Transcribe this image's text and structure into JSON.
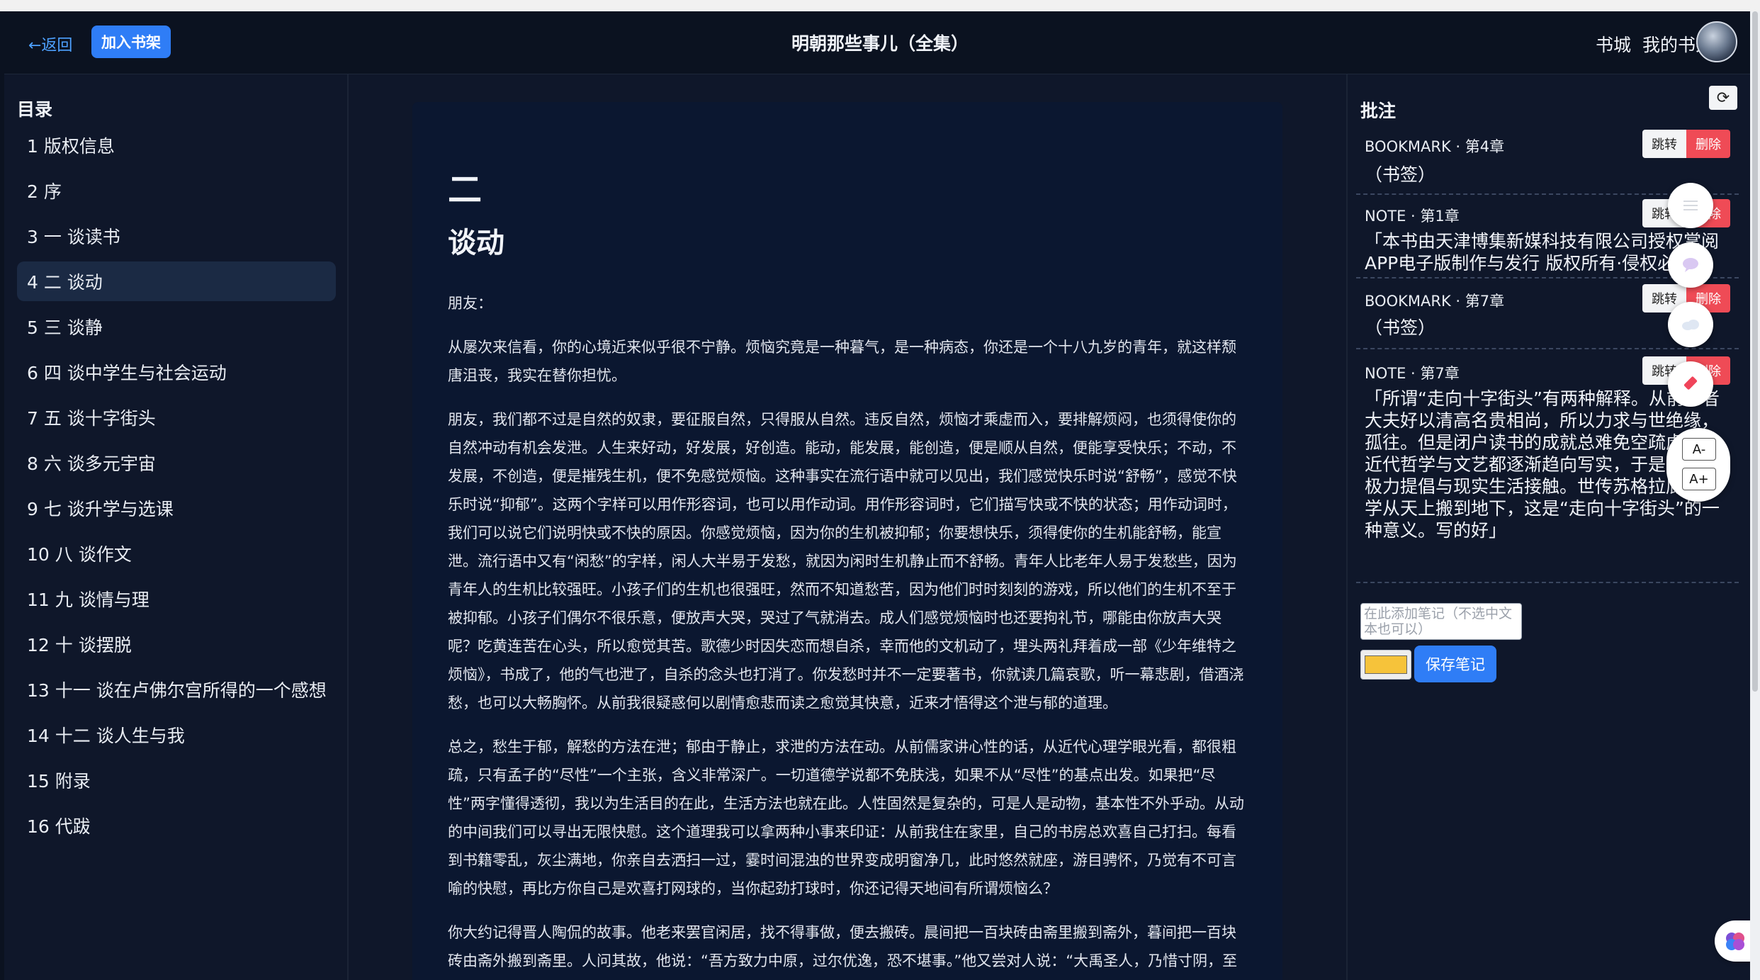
{
  "header": {
    "back_label": "←返回",
    "add_shelf_label": "加入书架",
    "title": "明朝那些事儿（全集）",
    "nav": [
      "书城",
      "我的书架"
    ]
  },
  "toc": {
    "heading": "目录",
    "items": [
      {
        "label": "1 版权信息"
      },
      {
        "label": "2 序"
      },
      {
        "label": "3 一 谈读书"
      },
      {
        "label": "4 二 谈动"
      },
      {
        "label": "5 三 谈静"
      },
      {
        "label": "6 四 谈中学生与社会运动"
      },
      {
        "label": "7 五 谈十字街头"
      },
      {
        "label": "8 六 谈多元宇宙"
      },
      {
        "label": "9 七 谈升学与选课"
      },
      {
        "label": "10 八 谈作文"
      },
      {
        "label": "11 九 谈情与理"
      },
      {
        "label": "12 十 谈摆脱"
      },
      {
        "label": "13 十一 谈在卢佛尔宫所得的一个感想"
      },
      {
        "label": "14 十二 谈人生与我"
      },
      {
        "label": "15 附录"
      },
      {
        "label": "16 代跋"
      }
    ],
    "active_index": 3
  },
  "chapter": {
    "number": "二",
    "title": "谈动",
    "paragraphs": [
      "朋友：",
      "从屡次来信看，你的心境近来似乎很不宁静。烦恼究竟是一种暮气，是一种病态，你还是一个十八九岁的青年，就这样颓唐沮丧，我实在替你担忧。",
      "朋友，我们都不过是自然的奴隶，要征服自然，只得服从自然。违反自然，烦恼才乘虚而入，要排解烦闷，也须得使你的自然冲动有机会发泄。人生来好动，好发展，好创造。能动，能发展，能创造，便是顺从自然，便能享受快乐；不动，不发展，不创造，便是摧残生机，便不免感觉烦恼。这种事实在流行语中就可以见出，我们感觉快乐时说“舒畅”，感觉不快乐时说“抑郁”。这两个字样可以用作形容词，也可以用作动词。用作形容词时，它们描写快或不快的状态；用作动词时，我们可以说它们说明快或不快的原因。你感觉烦恼，因为你的生机被抑郁；你要想快乐，须得使你的生机能舒畅，能宣泄。流行语中又有“闲愁”的字样，闲人大半易于发愁，就因为闲时生机静止而不舒畅。青年人比老年人易于发愁些，因为青年人的生机比较强旺。小孩子们的生机也很强旺，然而不知道愁苦，因为他们时时刻刻的游戏，所以他们的生机不至于被抑郁。小孩子们偶尔不很乐意，便放声大哭，哭过了气就消去。成人们感觉烦恼时也还要拘礼节，哪能由你放声大哭呢？吃黄连苦在心头，所以愈觉其苦。歌德少时因失恋而想自杀，幸而他的文机动了，埋头两礼拜着成一部《少年维特之烦恼》，书成了，他的气也泄了，自杀的念头也打消了。你发愁时并不一定要著书，你就读几篇哀歌，听一幕悲剧，借酒浇愁，也可以大畅胸怀。从前我很疑惑何以剧情愈悲而读之愈觉其快意，近来才悟得这个泄与郁的道理。",
      "总之，愁生于郁，解愁的方法在泄；郁由于静止，求泄的方法在动。从前儒家讲心性的话，从近代心理学眼光看，都很粗疏，只有孟子的“尽性”一个主张，含义非常深广。一切道德学说都不免肤浅，如果不从“尽性”的基点出发。如果把“尽性”两字懂得透彻，我以为生活目的在此，生活方法也就在此。人性固然是复杂的，可是人是动物，基本性不外乎动。从动的中间我们可以寻出无限快慰。这个道理我可以拿两种小事来印证：从前我住在家里，自己的书房总欢喜自己打扫。每看到书籍零乱，灰尘满地，你亲自去洒扫一过，霎时间混浊的世界变成明窗净几，此时悠然就座，游目骋怀，乃觉有不可言喻的快慰，再比方你自己是欢喜打网球的，当你起劲打球时，你还记得天地间有所谓烦恼么？",
      "你大约记得晋人陶侃的故事。他老来罢官闲居，找不得事做，便去搬砖。晨间把一百块砖由斋里搬到斋外，暮间把一百块砖由斋外搬到斋里。人问其故，他说：“吾方致力中原，过尔优逸，恐不堪事。”他又尝对人说：“大禹圣人，乃惜寸阴，至于众人，当惜分阴。”"
    ]
  },
  "notes_panel": {
    "heading": "批注",
    "refresh_icon": "⟳",
    "jump_label": "跳转",
    "delete_label": "删除",
    "items": [
      {
        "type": "BOOKMARK · 第4章",
        "text": "（书签）"
      },
      {
        "type": "NOTE · 第1章",
        "text": "「本书由天津博集新媒科技有限公司授权掌阅APP电子版制作与发行 版权所有·侵权必究」"
      },
      {
        "type": "BOOKMARK · 第7章",
        "text": "（书签）"
      },
      {
        "type": "NOTE · 第7章",
        "text": "「所谓“走向十字街头”有两种解释。从前学者大夫好以清高名贵相尚，所以力求与世绝缘，孤往。但是闭户读书的成就总难免空疏虚泛，近代哲学与文艺都逐渐趋向写实，于是大家都极力提倡与现实生活接触。世传苏格拉底把哲学从天上搬到地下，这是“走向十字街头”的一种意义。写的好」"
      }
    ],
    "input_placeholder": "在此添加笔记（不选中文本也可以）",
    "highlight_color": "#f6c33a",
    "save_label": "保存笔记"
  },
  "floating_tools": {
    "font_decrease": "A-",
    "font_increase": "A+"
  }
}
